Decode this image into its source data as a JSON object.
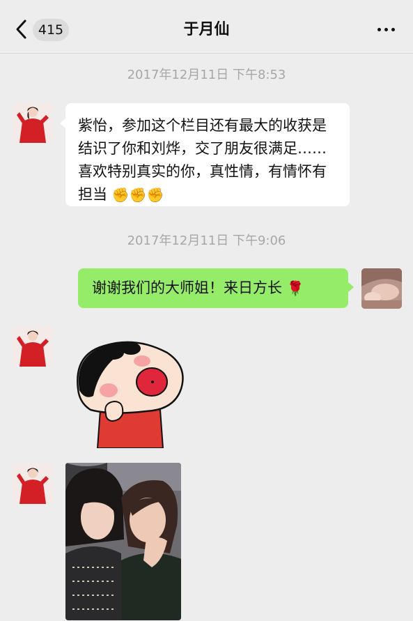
{
  "header": {
    "unread_count": "415",
    "title": "于月仙"
  },
  "messages": [
    {
      "timestamp": "2017年12月11日 下午8:53"
    },
    {
      "text": "紫怡，参加这个栏目还有最大的收获是结识了你和刘烨，交了朋友很满足……喜欢特别真实的你，真性情，有情怀有担当",
      "emoji": "✊✊✊"
    },
    {
      "timestamp": "2017年12月11日 下午9:06"
    },
    {
      "text": "谢谢我们的大师姐！来日方长",
      "emoji": "🌹"
    }
  ],
  "colors": {
    "background": "#ededed",
    "incoming_bubble": "#ffffff",
    "outgoing_bubble": "#95ec69",
    "timestamp": "#a7a7a7"
  },
  "icons": [
    "back-arrow-icon",
    "more-options-icon"
  ]
}
